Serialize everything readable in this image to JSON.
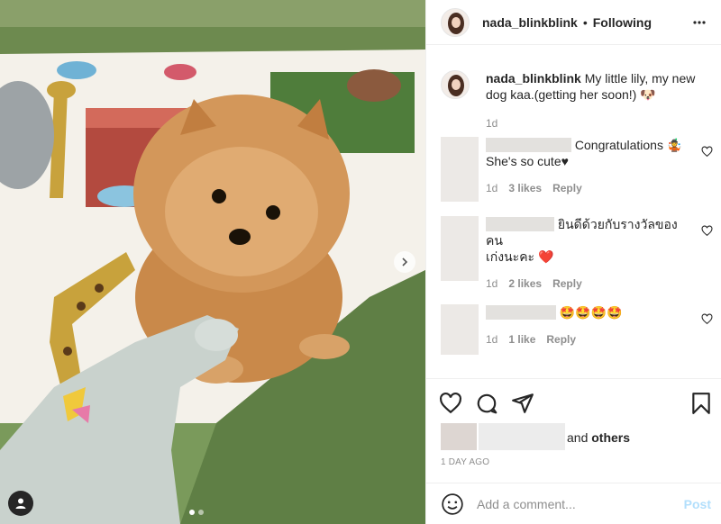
{
  "post": {
    "username": "nada_blinkblink",
    "separator": "•",
    "follow_status": "Following",
    "caption": "My little lily, my new dog kaa.(getting her soon!)",
    "caption_emoji": "🐶",
    "caption_time": "1d"
  },
  "comments": [
    {
      "text_line1": "Congratulations 🤹",
      "text_line2": "She's so cute♥",
      "time": "1d",
      "likes": "3 likes",
      "reply": "Reply"
    },
    {
      "text_line1": "ยินดีด้วยกับรางวัลของคน",
      "text_line2": "เก่งนะคะ ❤️",
      "time": "1d",
      "likes": "2 likes",
      "reply": "Reply"
    },
    {
      "text_line1": "🤩🤩🤩🤩",
      "text_line2": "",
      "time": "1d",
      "likes": "1 like",
      "reply": "Reply"
    }
  ],
  "likes_summary": {
    "and": "and",
    "others": "others"
  },
  "posted_ago": "1 DAY AGO",
  "add_comment": {
    "placeholder": "Add a comment...",
    "post_label": "Post"
  },
  "icons": [
    "more-icon",
    "heart-icon",
    "comment-icon",
    "share-icon",
    "bookmark-icon",
    "smile-icon",
    "user-tag-icon",
    "chevron-right-icon"
  ],
  "colors": {
    "post_disabled": "#b2dffc",
    "meta_gray": "#8e8e8e",
    "text": "#262626",
    "border": "#efefef"
  },
  "carousel": {
    "total": 2,
    "active": 1
  }
}
